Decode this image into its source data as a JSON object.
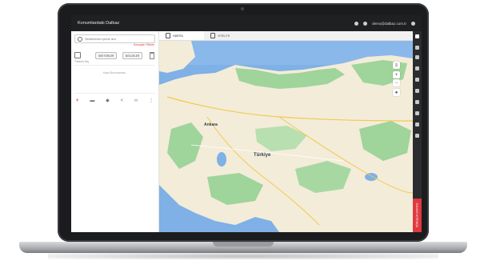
{
  "app": {
    "title": "Konumlardaki Dalbaz",
    "user_email": "demo@dalbaz.com.tr"
  },
  "sidebar": {
    "search_placeholder": "Sektörlerim içinde ara",
    "filter_link": "Sonuçları Filtrele",
    "btn_1": "SEKTÖRLER",
    "btn_2": "BÖLGELER",
    "select_all": "Tümünü Seç",
    "empty_message": "Kayıt Bulunamadı."
  },
  "tabs": [
    {
      "label": "HARİTA",
      "active": true
    },
    {
      "label": "VERİLER",
      "active": false
    }
  ],
  "map": {
    "labels": {
      "city": "Ankara",
      "country": "Türkiye"
    },
    "colors": {
      "sea": "#7fb0e6",
      "land": "#f3ecd9",
      "green": "#9fd49b"
    }
  },
  "rail": {
    "red_button": "DÖNÜŞÜM SAYFASI"
  },
  "icons": {
    "search": "search-icon",
    "trash": "trash-icon",
    "map_tab": "map-icon",
    "data_tab": "chart-icon",
    "add": "plus-icon"
  }
}
